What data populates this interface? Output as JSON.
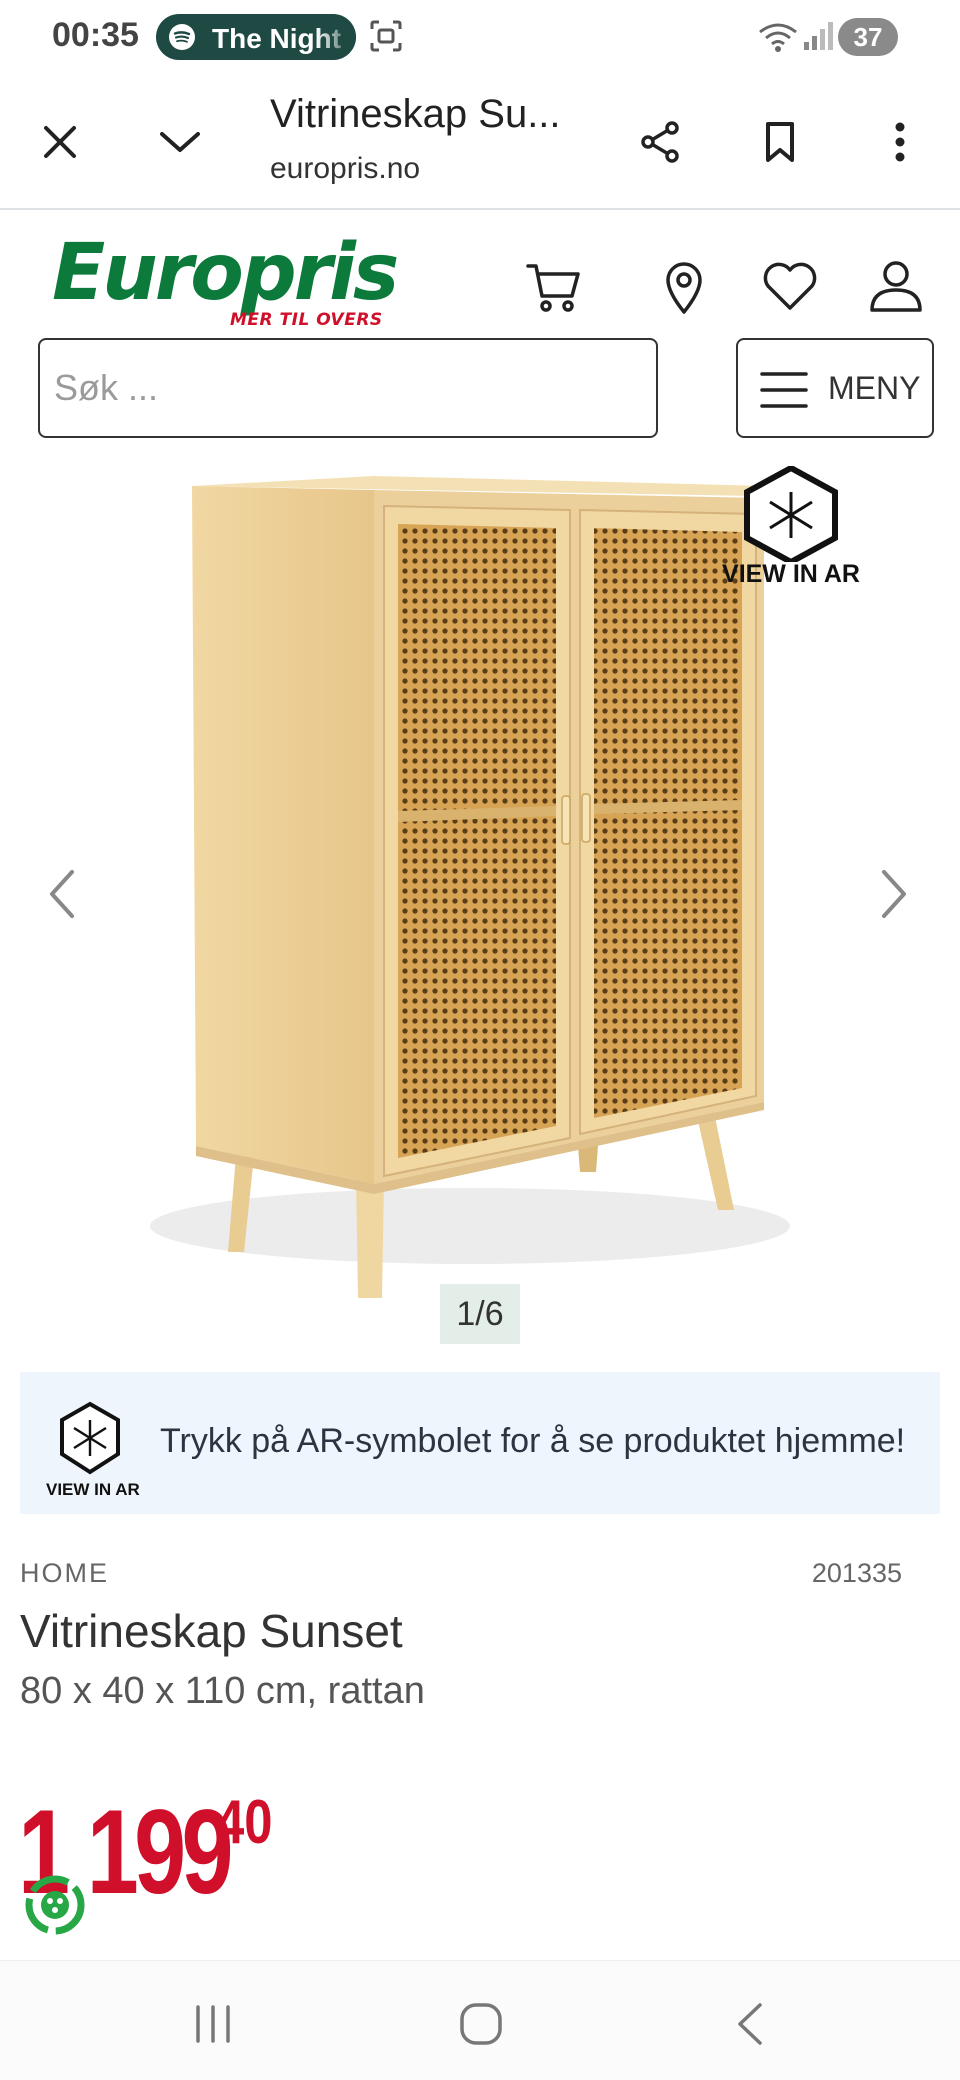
{
  "status_bar": {
    "time": "00:35",
    "media_pill_text": "The Night",
    "battery": "37"
  },
  "browser": {
    "page_title": "Vitrineskap Su...",
    "url": "europris.no"
  },
  "site": {
    "logo_text": "Europris",
    "logo_tagline": "MER TIL OVERS",
    "search_placeholder": "Søk ...",
    "menu_label": "MENY",
    "brand_green": "#0b7a3b",
    "brand_red": "#d0102a"
  },
  "gallery": {
    "ar_badge_label": "VIEW IN AR",
    "counter": "1/6"
  },
  "ar_banner": {
    "icon_label": "VIEW IN AR",
    "text": "Trykk på AR-symbolet for å se produktet hjemme!"
  },
  "product": {
    "category": "HOME",
    "sku": "201335",
    "title": "Vitrineskap Sunset",
    "subtitle": "80 x 40 x 110 cm, rattan",
    "price_integer": "1 199",
    "price_decimal": "40"
  }
}
